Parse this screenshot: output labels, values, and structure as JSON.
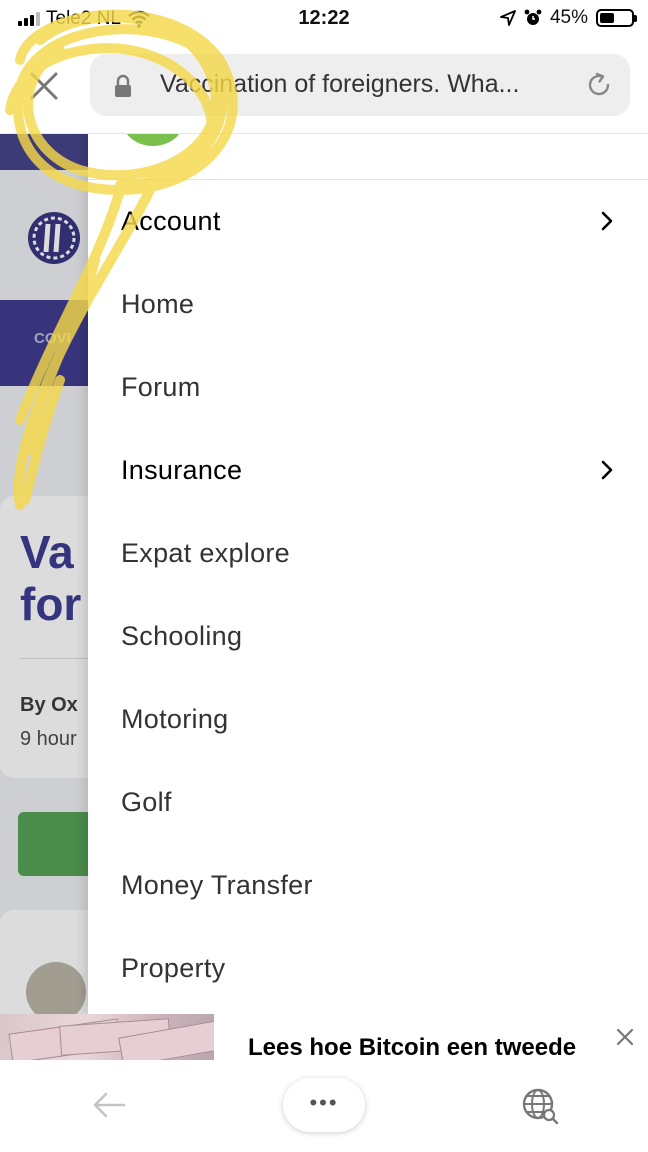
{
  "status_bar": {
    "carrier": "Tele2 NL",
    "time": "12:22",
    "battery": "45%",
    "battery_level": 0.45
  },
  "browser": {
    "url_title": "Vaccination of foreigners. Wha...",
    "icons": {
      "close": "close-icon",
      "lock": "lock-icon",
      "reload": "reload-icon"
    }
  },
  "background_page": {
    "nav_label": "COVI",
    "headline": "Va\nfor",
    "author": "By Ox",
    "time_ago": "9 hour"
  },
  "menu": {
    "items": [
      {
        "label": "Account",
        "has_submenu": true
      },
      {
        "label": "Home",
        "has_submenu": false
      },
      {
        "label": "Forum",
        "has_submenu": false
      },
      {
        "label": "Insurance",
        "has_submenu": true
      },
      {
        "label": "Expat explore",
        "has_submenu": false
      },
      {
        "label": "Schooling",
        "has_submenu": false
      },
      {
        "label": "Motoring",
        "has_submenu": false
      },
      {
        "label": "Golf",
        "has_submenu": false
      },
      {
        "label": "Money Transfer",
        "has_submenu": false
      },
      {
        "label": "Property",
        "has_submenu": false
      }
    ]
  },
  "ad": {
    "text": "Lees hoe Bitcoin een tweede"
  },
  "toolbar": {
    "more_label": "•••",
    "icons": {
      "back": "back-arrow-icon",
      "globe": "globe-icon"
    }
  },
  "colors": {
    "brand_purple": "#36338a",
    "headline_purple": "#34348e",
    "green_button": "#4e9f4e",
    "scribble_yellow": "#f5d84a"
  }
}
